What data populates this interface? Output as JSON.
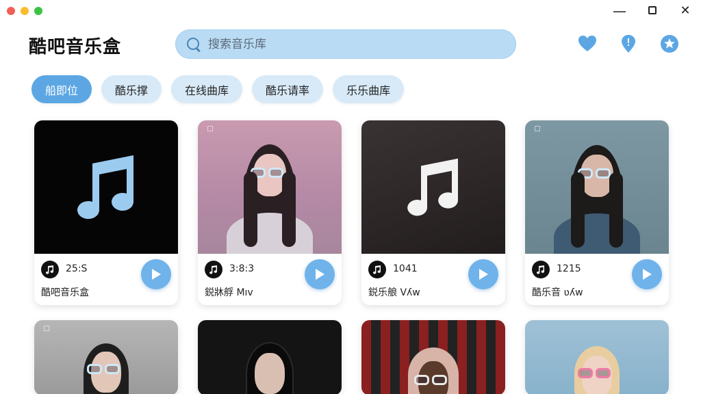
{
  "app": {
    "title": "酷吧音乐盒"
  },
  "search": {
    "placeholder": "搜索音乐库"
  },
  "header_icons": [
    {
      "name": "heart-icon"
    },
    {
      "name": "location-icon"
    },
    {
      "name": "star-badge-icon"
    }
  ],
  "tabs": [
    {
      "label": "船即位",
      "active": true
    },
    {
      "label": "酷乐撑",
      "active": false
    },
    {
      "label": "在线曲库",
      "active": false
    },
    {
      "label": "酷乐请率",
      "active": false
    },
    {
      "label": "乐乐曲库",
      "active": false
    }
  ],
  "cards": [
    {
      "count": "25:S",
      "name": "酷吧音乐盒",
      "cover": "music-note-blue"
    },
    {
      "count": "3:8:3",
      "name": "鋭牀艀 Mıv",
      "cover": "portrait-pink"
    },
    {
      "count": "1041",
      "name": "鋭乐艆 Vʎw",
      "cover": "music-note-dark"
    },
    {
      "count": "1215",
      "name": "酷乐音 ʋʎw",
      "cover": "portrait-teal"
    }
  ],
  "colors": {
    "accent": "#5ca7e3",
    "tab_bg": "#d8eaf8",
    "search_bg": "#b9dbf4",
    "play": "#6fb3ea"
  }
}
